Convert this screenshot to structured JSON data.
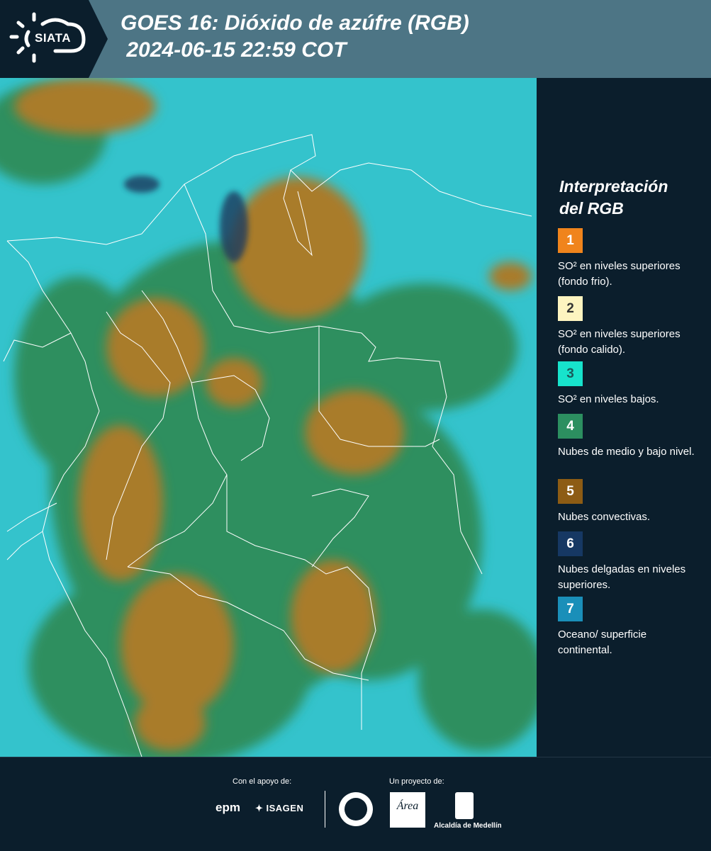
{
  "header": {
    "logo_text": "SIATA",
    "title_line1": "GOES 16: Dióxido de azúfre (RGB)",
    "title_line2": " 2024-06-15 22:59 COT"
  },
  "map": {
    "type": "satellite-rgb-composite",
    "colors": {
      "ocean": "#34c3cc",
      "low_clouds": "#2f8f5f",
      "convective": "#a97b2c",
      "thin_high": "#1d3a5f",
      "borders": "#ffffff"
    }
  },
  "legend": {
    "title_line1": "Interpretación",
    "title_line2": "del RGB",
    "items": [
      {
        "number": "1",
        "color": "#f0841c",
        "text": "SO² en niveles superiores (fondo frio)."
      },
      {
        "number": "2",
        "color": "#fdf4c0",
        "text": "SO² en niveles superiores (fondo calido)."
      },
      {
        "number": "3",
        "color": "#17e3cc",
        "text": "SO² en niveles bajos."
      },
      {
        "number": "4",
        "color": "#2c8f60",
        "text": "Nubes de medio y bajo nivel."
      },
      {
        "number": "5",
        "color": "#8d5c14",
        "text": "Nubes convectivas."
      },
      {
        "number": "6",
        "color": "#163863",
        "text": "Nubes delgadas en niveles superiores."
      },
      {
        "number": "7",
        "color": "#1a8fb9",
        "text": "Oceano/ superficie continental."
      }
    ]
  },
  "footer": {
    "support_label": "Con el apoyo de:",
    "project_label": "Un proyecto de:",
    "sponsor1": "epm",
    "sponsor2": "ISAGEN",
    "partner_amva": "Área",
    "partner_alcaldia": "Alcaldía de Medellín"
  }
}
